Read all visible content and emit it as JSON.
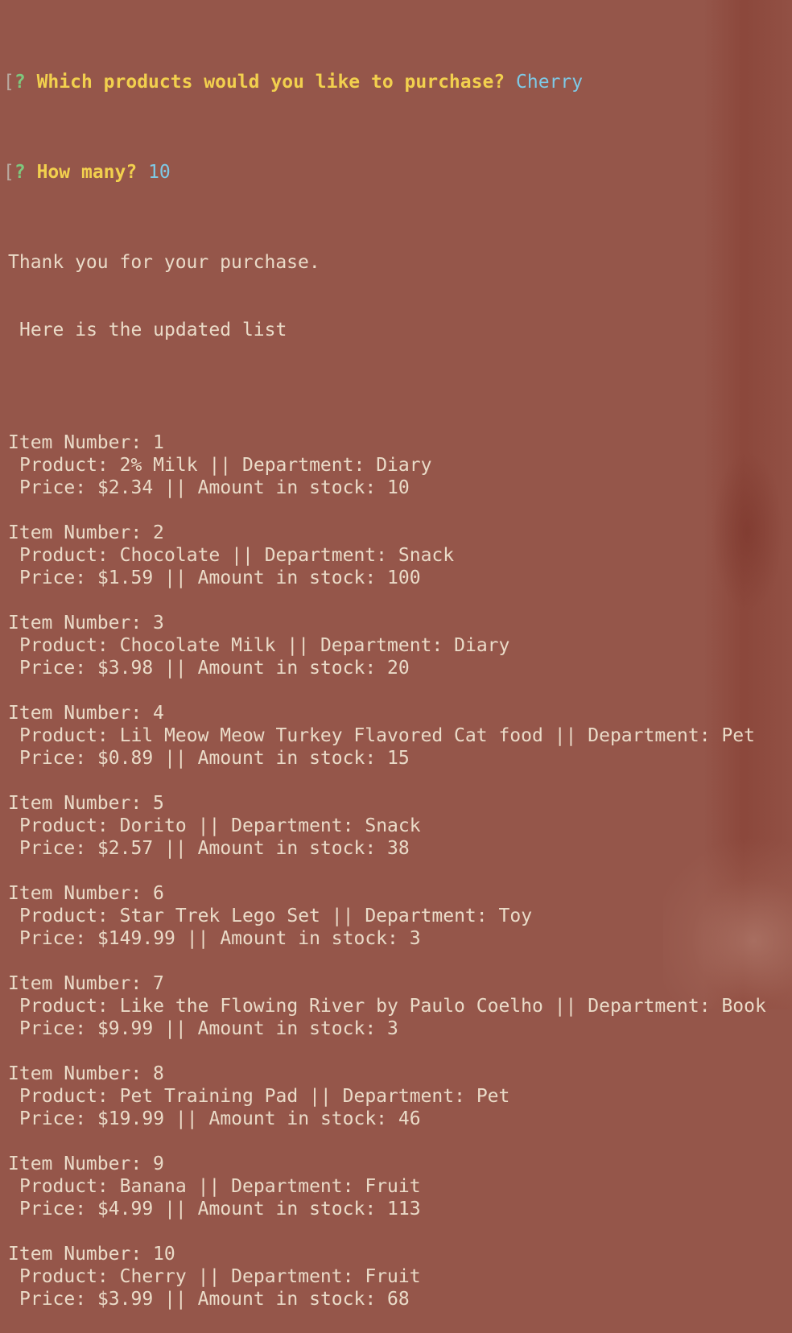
{
  "prompts": [
    {
      "bracket": "[",
      "mark": "?",
      "question": "Which products would you like to purchase?",
      "answer": "Cherry"
    },
    {
      "bracket": "[",
      "mark": "?",
      "question": "How many?",
      "answer": "10"
    }
  ],
  "message": {
    "thanks": "Thank you for your purchase.",
    "list_intro": "Here is the updated list"
  },
  "labels": {
    "item_number": "Item Number:",
    "product": "Product:",
    "department": "Department:",
    "price": "Price:",
    "stock": "Amount in stock:",
    "sep": "||"
  },
  "items": [
    {
      "number": "1",
      "product": "2% Milk",
      "department": "Diary",
      "price": "$2.34",
      "stock": "10"
    },
    {
      "number": "2",
      "product": "Chocolate",
      "department": "Snack",
      "price": "$1.59",
      "stock": "100"
    },
    {
      "number": "3",
      "product": "Chocolate Milk",
      "department": "Diary",
      "price": "$3.98",
      "stock": "20"
    },
    {
      "number": "4",
      "product": "Lil Meow Meow Turkey Flavored Cat food",
      "department": "Pet",
      "price": "$0.89",
      "stock": "15"
    },
    {
      "number": "5",
      "product": "Dorito",
      "department": "Snack",
      "price": "$2.57",
      "stock": "38"
    },
    {
      "number": "6",
      "product": "Star Trek Lego Set",
      "department": "Toy",
      "price": "$149.99",
      "stock": "3"
    },
    {
      "number": "7",
      "product": "Like the Flowing River by Paulo Coelho",
      "department": "Book",
      "price": "$9.99",
      "stock": "3"
    },
    {
      "number": "8",
      "product": "Pet Training Pad",
      "department": "Pet",
      "price": "$19.99",
      "stock": "46"
    },
    {
      "number": "9",
      "product": "Banana",
      "department": "Fruit",
      "price": "$4.99",
      "stock": "113"
    },
    {
      "number": "10",
      "product": "Cherry",
      "department": "Fruit",
      "price": "$3.99",
      "stock": "68"
    }
  ]
}
